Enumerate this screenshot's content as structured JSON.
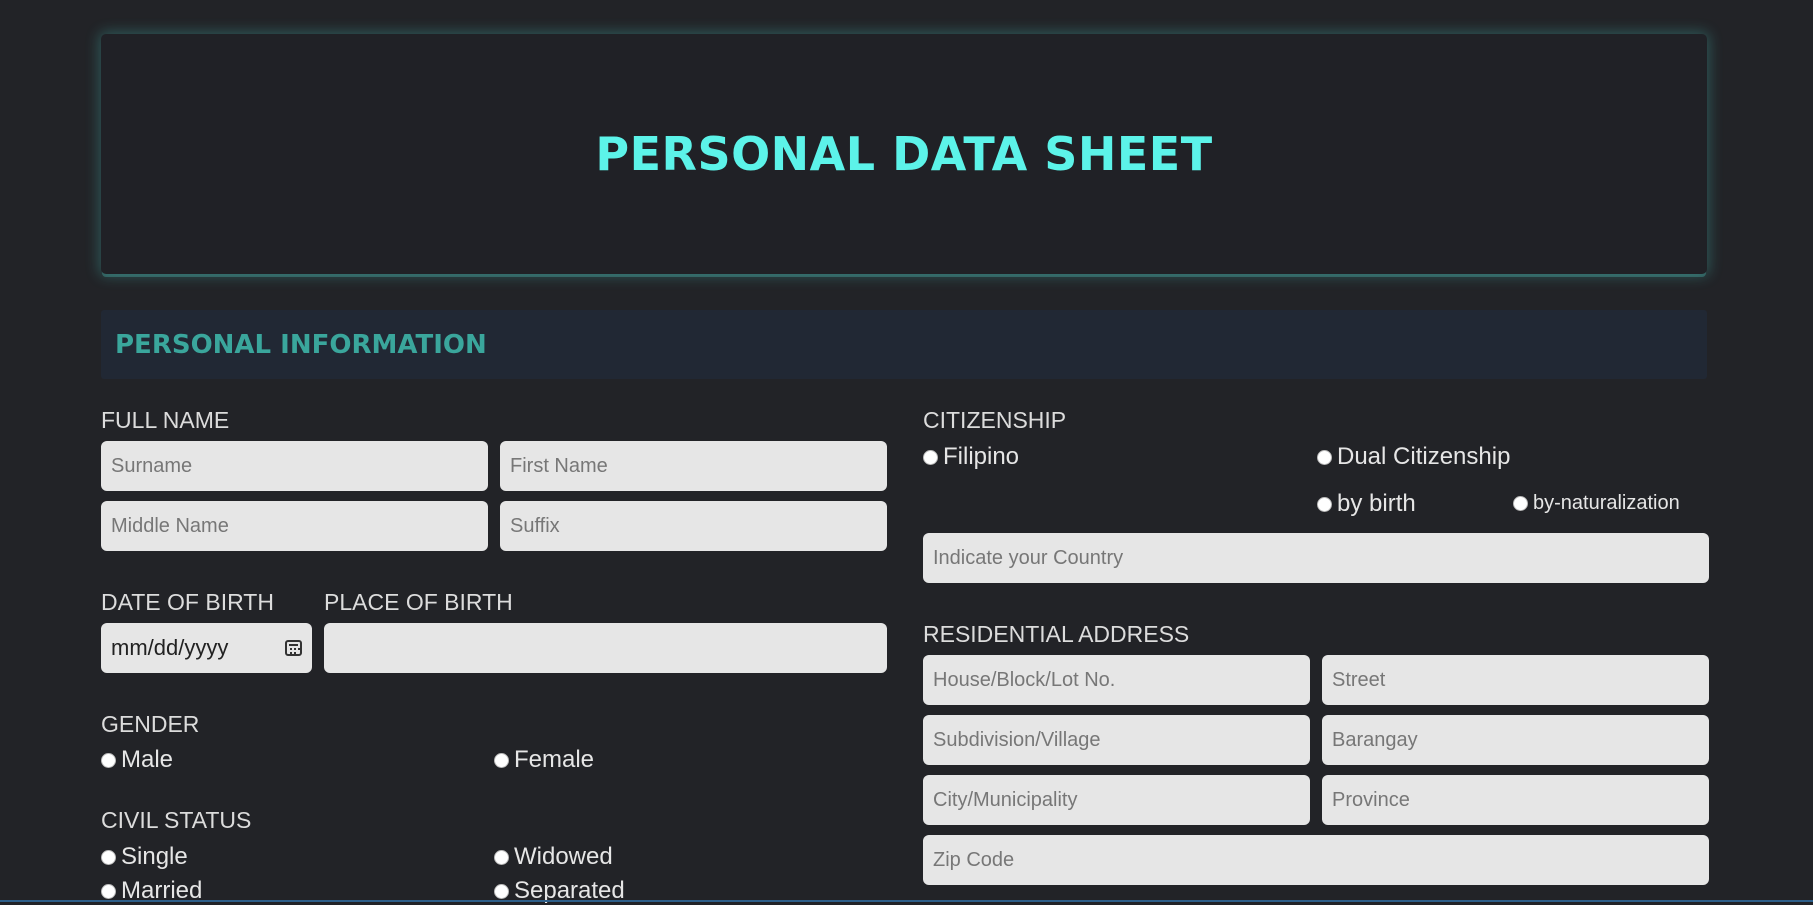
{
  "header": {
    "title": "PERSONAL DATA SHEET"
  },
  "section": {
    "title": "PERSONAL INFORMATION"
  },
  "full_name": {
    "label": "FULL NAME",
    "surname_placeholder": "Surname",
    "first_name_placeholder": "First Name",
    "middle_name_placeholder": "Middle Name",
    "suffix_placeholder": "Suffix"
  },
  "dob": {
    "label": "DATE OF BIRTH",
    "placeholder": "mm/dd/yyyy"
  },
  "pob": {
    "label": "PLACE OF BIRTH"
  },
  "gender": {
    "label": "GENDER",
    "options": [
      "Male",
      "Female"
    ]
  },
  "civil_status": {
    "label": "CIVIL STATUS",
    "options": [
      "Single",
      "Widowed",
      "Married",
      "Separated"
    ]
  },
  "citizenship": {
    "label": "CITIZENSHIP",
    "filipino": "Filipino",
    "dual": "Dual Citizenship",
    "by_birth": "by birth",
    "by_naturalization": "by-naturalization",
    "country_placeholder": "Indicate your Country"
  },
  "address": {
    "label": "RESIDENTIAL ADDRESS",
    "house_placeholder": "House/Block/Lot No.",
    "street_placeholder": "Street",
    "subdivision_placeholder": "Subdivision/Village",
    "barangay_placeholder": "Barangay",
    "city_placeholder": "City/Municipality",
    "province_placeholder": "Province",
    "zip_placeholder": "Zip Code"
  }
}
